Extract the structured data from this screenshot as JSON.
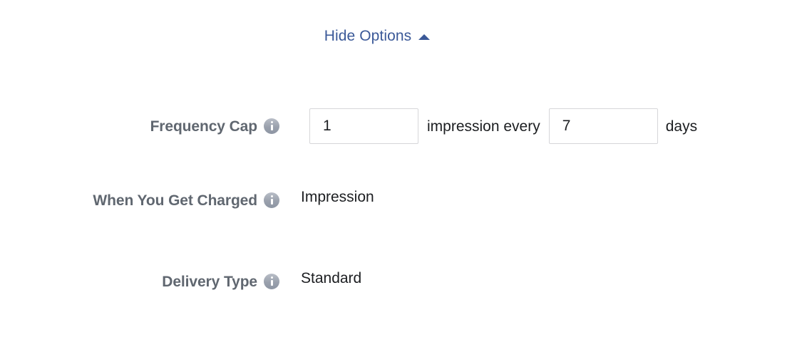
{
  "toggle": {
    "label": "Hide Options",
    "icon": "caret-up-icon",
    "link_color": "#3b5998"
  },
  "colors": {
    "label_text": "#606770",
    "value_text": "#1c1e21",
    "input_border": "#d6d6d9",
    "info_icon": "#9aa1ad",
    "background": "#ffffff"
  },
  "form": {
    "rows": [
      {
        "label": "Frequency Cap",
        "info_icon": "info-icon",
        "type": "frequency",
        "count_value": "1",
        "count_placeholder": "",
        "middle_text": "impression every",
        "interval_value": "7",
        "interval_placeholder": "",
        "unit_text": "days"
      },
      {
        "label": "When You Get Charged",
        "info_icon": "info-icon",
        "type": "static",
        "value": "Impression"
      },
      {
        "label": "Delivery Type",
        "info_icon": "info-icon",
        "type": "static",
        "value": "Standard"
      }
    ]
  }
}
